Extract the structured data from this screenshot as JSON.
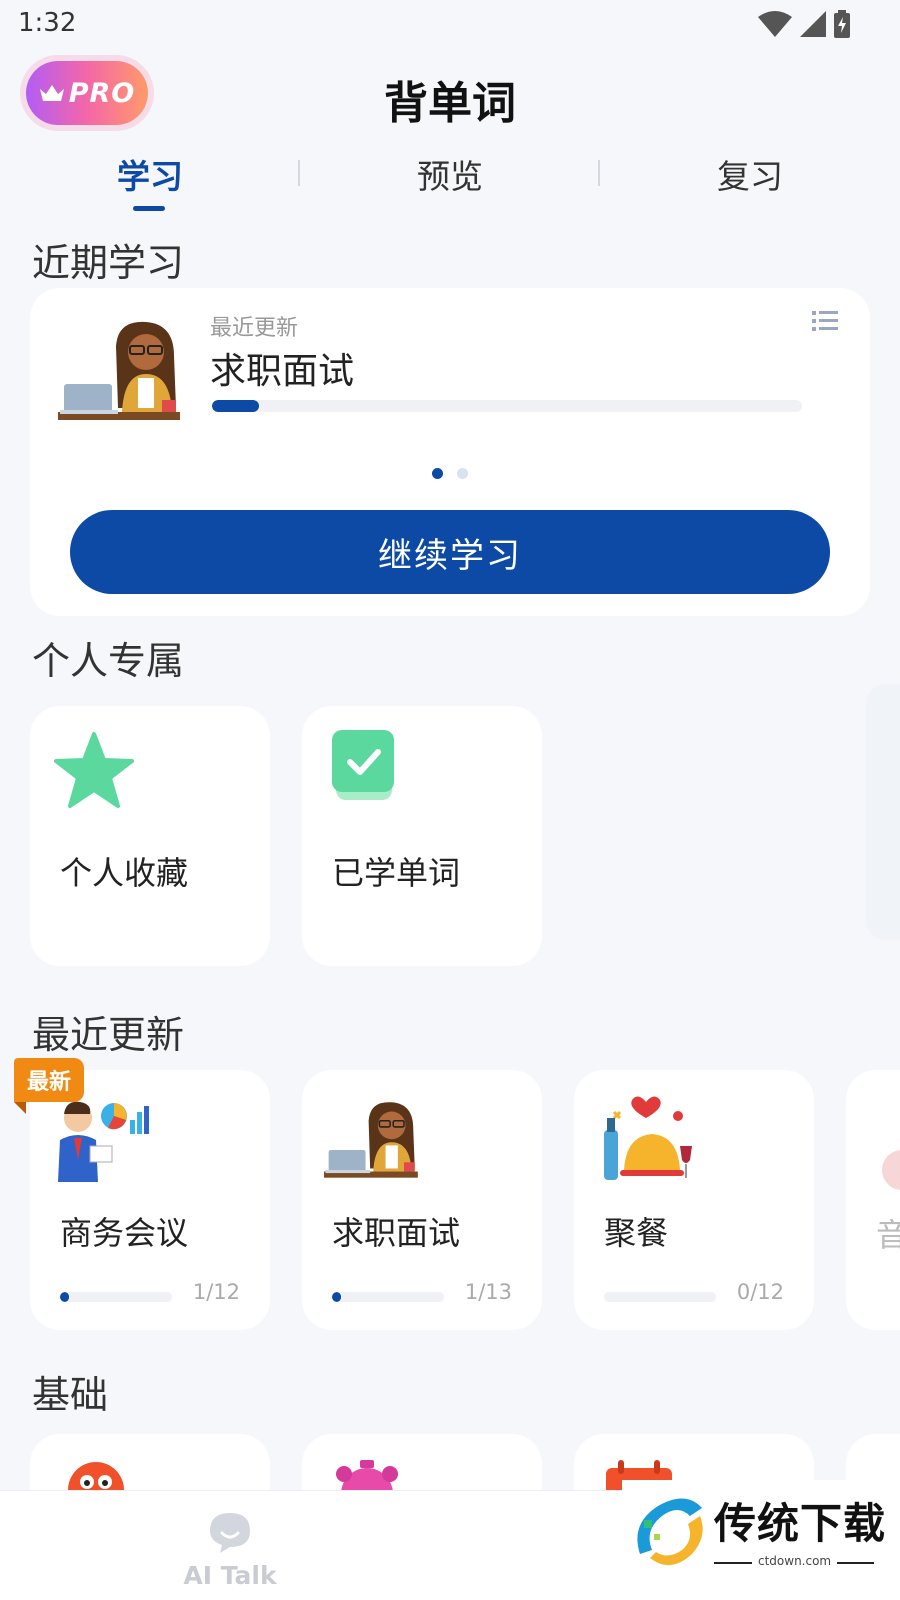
{
  "status_bar": {
    "time": "1:32"
  },
  "header": {
    "pro_label": "PRO",
    "title": "背单词"
  },
  "tabs": [
    {
      "label": "学习"
    },
    {
      "label": "预览"
    },
    {
      "label": "复习"
    }
  ],
  "recent_study": {
    "section_title": "近期学习",
    "subtitle": "最近更新",
    "topic": "求职面试",
    "progress": 0.08,
    "continue_label": "继续学习"
  },
  "personal": {
    "section_title": "个人专属",
    "favorites_label": "个人收藏",
    "learned_label": "已学单词"
  },
  "recent_updates": {
    "section_title": "最近更新",
    "new_badge": "最新",
    "courses": [
      {
        "name": "商务会议",
        "count": "1/12",
        "progress": 0.0833
      },
      {
        "name": "求职面试",
        "count": "1/13",
        "progress": 0.0769
      },
      {
        "name": "聚餐",
        "count": "0/12",
        "progress": 0
      }
    ],
    "partial_card_text": "音"
  },
  "basics": {
    "section_title": "基础"
  },
  "bottom_nav": {
    "ai_talk_label": "AI Talk"
  },
  "watermark": {
    "title": "传统下载",
    "url": "ctdown.com"
  },
  "colors": {
    "accent": "#0c4aa6",
    "green": "#5bd89d",
    "badge_orange": "#f08a12"
  }
}
